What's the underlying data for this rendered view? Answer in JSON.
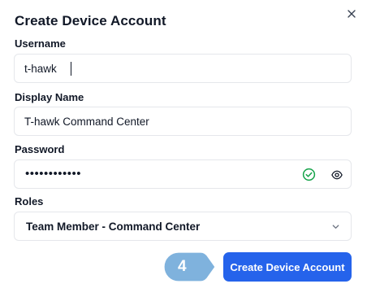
{
  "dialog": {
    "title": "Create Device Account",
    "close_icon": "close-icon"
  },
  "username": {
    "label": "Username",
    "value": "t-hawk"
  },
  "display_name": {
    "label": "Display Name",
    "value": "T-hawk Command Center"
  },
  "password": {
    "label": "Password",
    "masked_value": "••••••••••••",
    "valid_icon": "check-circle-icon",
    "reveal_icon": "eye-icon",
    "valid_color": "#16a34a"
  },
  "roles": {
    "label": "Roles",
    "selected": "Team Member - Command Center",
    "dropdown_icon": "chevron-down-icon"
  },
  "step_marker": {
    "number": "4",
    "color": "#7fb2dd"
  },
  "actions": {
    "create_label": "Create Device Account",
    "accent": "#2563eb"
  }
}
